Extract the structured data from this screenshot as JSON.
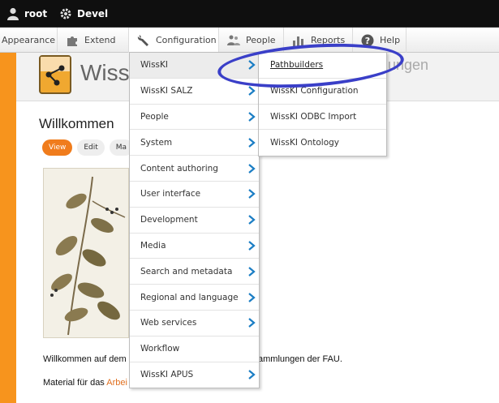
{
  "toolbar": {
    "user_label": "root",
    "devel_label": "Devel"
  },
  "tray": {
    "items": [
      {
        "label": "Appearance",
        "icon": "appearance-icon"
      },
      {
        "label": "Extend",
        "icon": "puzzle-icon"
      },
      {
        "label": "Configuration",
        "icon": "wrench-icon"
      },
      {
        "label": "People",
        "icon": "people-icon"
      },
      {
        "label": "Reports",
        "icon": "bar-chart-icon"
      },
      {
        "label": "Help",
        "icon": "help-icon"
      }
    ]
  },
  "site": {
    "name": "Wiss",
    "slogan": "ungen"
  },
  "page": {
    "title": "Willkommen",
    "tabs": [
      "View",
      "Edit",
      "Ma"
    ],
    "intro_prefix": "Willkommen auf dem",
    "intro_suffix": "ammlungen der FAU.",
    "material_prefix": "Material für das",
    "material_link": "Arbei"
  },
  "config_menu": {
    "items": [
      {
        "label": "WissKI",
        "has_sub": true
      },
      {
        "label": "WissKI SALZ",
        "has_sub": true
      },
      {
        "label": "People",
        "has_sub": true
      },
      {
        "label": "System",
        "has_sub": true
      },
      {
        "label": "Content authoring",
        "has_sub": true
      },
      {
        "label": "User interface",
        "has_sub": true
      },
      {
        "label": "Development",
        "has_sub": true
      },
      {
        "label": "Media",
        "has_sub": true
      },
      {
        "label": "Search and metadata",
        "has_sub": true
      },
      {
        "label": "Regional and language",
        "has_sub": true
      },
      {
        "label": "Web services",
        "has_sub": true
      },
      {
        "label": "Workflow",
        "has_sub": false
      },
      {
        "label": "WissKI APUS",
        "has_sub": true
      }
    ]
  },
  "wisski_submenu": {
    "items": [
      "Pathbuilders",
      "WissKI Configuration",
      "WissKI ODBC Import",
      "WissKI Ontology"
    ]
  },
  "colors": {
    "accent": "#f7941d",
    "chevron": "#1a7dc4",
    "annotation": "#3a3fc8"
  }
}
